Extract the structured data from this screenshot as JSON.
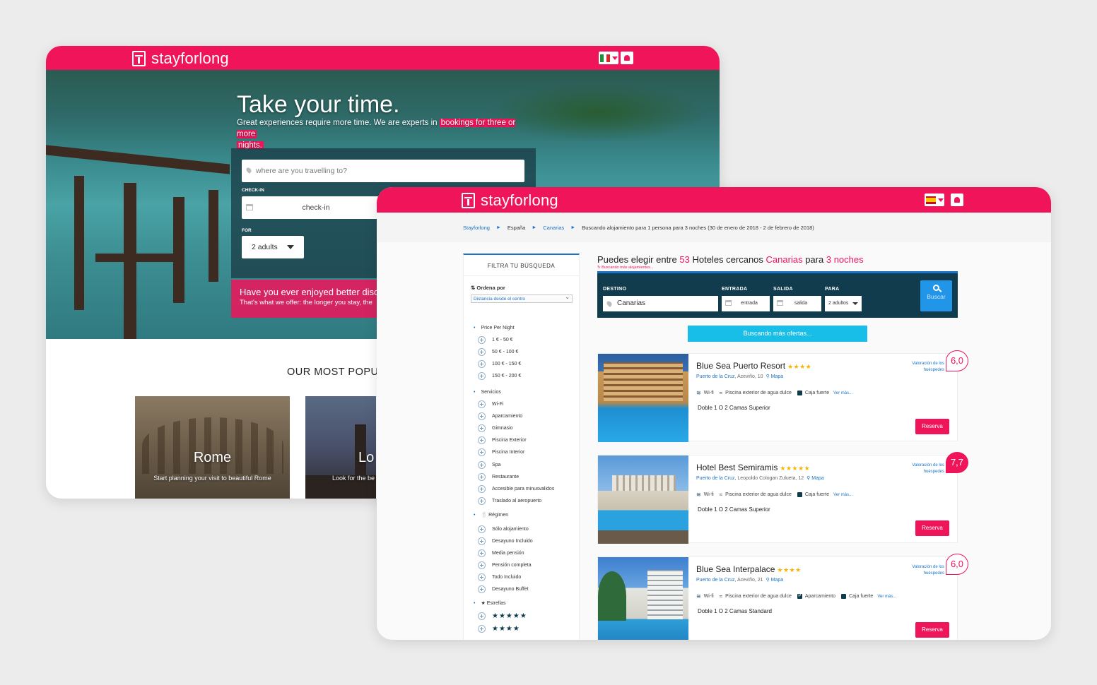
{
  "brand": {
    "name": "stayforlong",
    "accent": "#f0145a",
    "dark": "#103c4d",
    "link": "#1a73c8"
  },
  "home": {
    "flag_icon": "italy-flag-icon",
    "user_icon": "user-icon",
    "hero_title": "Take your time.",
    "hero_sub_prefix": "Great experiences require more time. We are experts in",
    "hero_sub_highlight": "bookings for three or more",
    "hero_sub_highlight2": "nights.",
    "search": {
      "placeholder": "where are you travelling to?",
      "checkin_label": "CHECK-IN",
      "checkin_value": "check-in",
      "for_label": "FOR",
      "adults_value": "2 adults"
    },
    "promo_title": "Have you ever enjoyed better disc",
    "promo_sub": "That's what we offer: the longer you stay, the",
    "popular_title": "OUR MOST POPU",
    "cities": [
      {
        "name": "Rome",
        "desc": "Start planning your visit to beautiful Rome"
      },
      {
        "name": "Lo",
        "desc": "Look for the be"
      }
    ]
  },
  "results": {
    "flag_icon": "spain-flag-icon",
    "user_icon": "user-icon",
    "breadcrumb": {
      "items": [
        "Stayforlong",
        "España",
        "Canarias"
      ],
      "current": "Buscando alojamiento para 1 persona para 3 noches (30 de enero de 2018 - 2 de febrero de 2018)"
    },
    "filters": {
      "title": "FILTRA TU BÚSQUEDA",
      "sort_label": "Ordena por",
      "sort_value": "Distancia desde el centro",
      "price_title": "Price Per Night",
      "prices": [
        "1 € - 50 €",
        "50 € - 100 €",
        "100 € - 150 €",
        "150 € - 200 €"
      ],
      "services_title": "Servicios",
      "services": [
        "Wi-Fi",
        "Aparcamiento",
        "Gimnasio",
        "Piscina Exterior",
        "Piscina Interior",
        "Spa",
        "Restaurante",
        "Accesible para minusvalidos",
        "Traslado al aeropuerto"
      ],
      "regime_title": "Régimen",
      "regimes": [
        "Sólo alojamiento",
        "Desayuno Incluido",
        "Media pensión",
        "Pensión completa",
        "Todo Incluido",
        "Desayuno Buffet"
      ],
      "stars_title": "Estrellas",
      "stars": [
        "★★★★★",
        "★★★★"
      ]
    },
    "headline": {
      "pre": "Puedes elegir entre",
      "count": "53",
      "mid": "Hoteles cercanos",
      "place": "Canarias",
      "para": "para",
      "nights": "3 noches"
    },
    "subnote": "Buscando más alojamientos...",
    "searchbar": {
      "destino_label": "DESTINO",
      "destino_value": "Canarias",
      "entrada_label": "ENTRADA",
      "entrada_value": "entrada",
      "salida_label": "SALIDA",
      "salida_value": "salida",
      "para_label": "PARA",
      "para_value": "2 adultos",
      "button": "Buscar"
    },
    "loading": "Buscando más ofertas...",
    "hotels": [
      {
        "name": "Blue Sea Puerto Resort",
        "stars": "★★★★",
        "city": "Puerto de la Cruz",
        "address": ", Aceviño, 10",
        "map": "Mapa",
        "amenities": [
          "Wi-fi",
          "Piscina exterior de agua dulce",
          "Caja fuerte"
        ],
        "more": "Ver más...",
        "room": "Doble 1 O 2 Camas Superior",
        "rating_label": "Valoración de los huéspedes",
        "score": "6,0",
        "reserve": "Reserva"
      },
      {
        "name": "Hotel Best Semiramis",
        "stars": "★★★★★",
        "city": "Puerto de la Cruz",
        "address": ", Leopoldo Cologan Zulueta, 12",
        "map": "Mapa",
        "amenities": [
          "Wi-fi",
          "Piscina exterior de agua dulce",
          "Caja fuerte"
        ],
        "more": "Ver más...",
        "room": "Doble 1 O 2 Camas Superior",
        "rating_label": "Valoración de los huéspedes",
        "score": "7,7",
        "reserve": "Reserva"
      },
      {
        "name": "Blue Sea Interpalace",
        "stars": "★★★★",
        "city": "Puerto de la Cruz",
        "address": ", Aceviño, 21",
        "map": "Mapa",
        "amenities": [
          "Wi-fi",
          "Piscina exterior de agua dulce",
          "Aparcamiento",
          "Caja fuerte"
        ],
        "more": "Ver más...",
        "room": "Doble 1 O 2 Camas Standard",
        "rating_label": "Valoración de los huéspedes",
        "score": "6,0",
        "reserve": "Reserva"
      }
    ]
  }
}
